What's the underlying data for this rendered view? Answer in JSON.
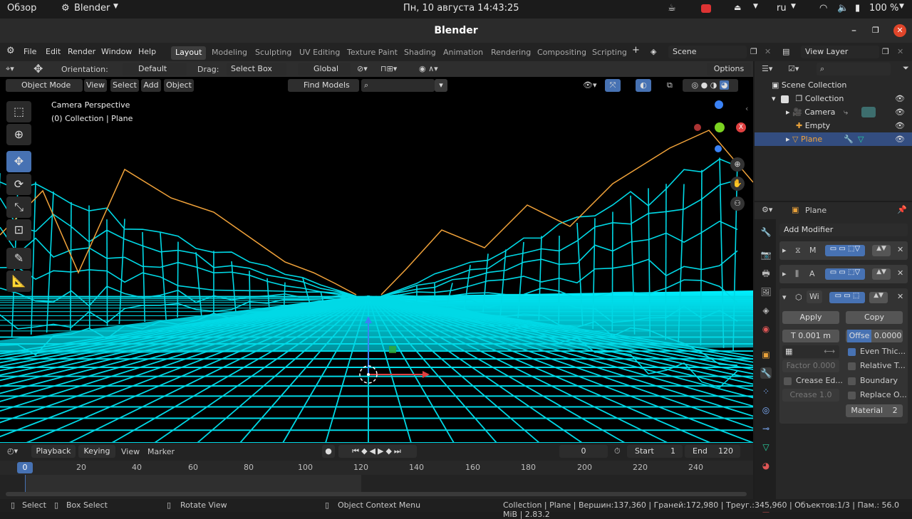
{
  "system_bar": {
    "activities": "Обзор",
    "app_name": "Blender",
    "datetime": "Пн, 10 августа  14:43:25",
    "language": "ru",
    "battery": "100 %"
  },
  "window": {
    "title": "Blender"
  },
  "menu": {
    "items": [
      "File",
      "Edit",
      "Render",
      "Window",
      "Help"
    ]
  },
  "workspaces": {
    "tabs": [
      "Layout",
      "Modeling",
      "Sculpting",
      "UV Editing",
      "Texture Paint",
      "Shading",
      "Animation",
      "Rendering",
      "Compositing",
      "Scripting"
    ],
    "active": "Layout",
    "add": "+"
  },
  "scene": {
    "name": "Scene",
    "view_layer": "View Layer"
  },
  "tool_header": {
    "orientation_label": "Orientation:",
    "orientation_value": "Default",
    "drag_label": "Drag:",
    "drag_value": "Select Box",
    "transform_space": "Global",
    "options": "Options"
  },
  "viewport_header": {
    "mode": "Object Mode",
    "view": "View",
    "select": "Select",
    "add": "Add",
    "object": "Object",
    "find_models": "Find Models"
  },
  "viewport": {
    "camera_label": "Camera Perspective",
    "collection_label": "(0) Collection | Plane",
    "gizmo": {
      "x": "X",
      "y": "Y",
      "z": "Z"
    }
  },
  "timeline": {
    "playback": "Playback",
    "keying": "Keying",
    "view": "View",
    "marker": "Marker",
    "current_frame": "0",
    "start_label": "Start",
    "start_value": "1",
    "end_label": "End",
    "end_value": "120",
    "ticks": [
      "0",
      "20",
      "40",
      "60",
      "80",
      "100",
      "120",
      "140",
      "160",
      "180",
      "200",
      "220",
      "240"
    ]
  },
  "outliner": {
    "root": "Scene Collection",
    "items": [
      {
        "name": "Collection",
        "icon": "collection-icon"
      },
      {
        "name": "Camera",
        "icon": "camera-icon"
      },
      {
        "name": "Empty",
        "icon": "empty-icon"
      },
      {
        "name": "Plane",
        "icon": "mesh-icon",
        "selected": true
      }
    ]
  },
  "properties": {
    "object_name": "Plane",
    "add_modifier": "Add Modifier",
    "modifiers": [
      {
        "short": "M"
      },
      {
        "short": "A"
      },
      {
        "short": "Wi"
      }
    ],
    "apply": "Apply",
    "copy": "Copy",
    "thickness": "T  0.001 m",
    "offset_label": "Offse",
    "offset_value": "0.0000",
    "even_thickness": "Even Thic...",
    "relative_thickness": "Relative T...",
    "factor": "Factor  0.000",
    "boundary": "Boundary",
    "crease_edges": "Crease Ed...",
    "replace_original": "Replace O...",
    "crease": "Crease  1.0",
    "material_label": "Material",
    "material_value": "2"
  },
  "status": {
    "select": "Select",
    "box_select": "Box Select",
    "rotate_view": "Rotate View",
    "context_menu": "Object Context Menu",
    "stats": "Collection | Plane | Вершин:137,360 | Граней:172,980 | Треуг.:345,960 | Объектов:1/3 | Пам.: 56.0 MiB | 2.83.2"
  },
  "colors": {
    "accent": "#4772b3",
    "wire": "#00e5ee",
    "selected_outline": "#f2a33a",
    "background": "#000000"
  }
}
